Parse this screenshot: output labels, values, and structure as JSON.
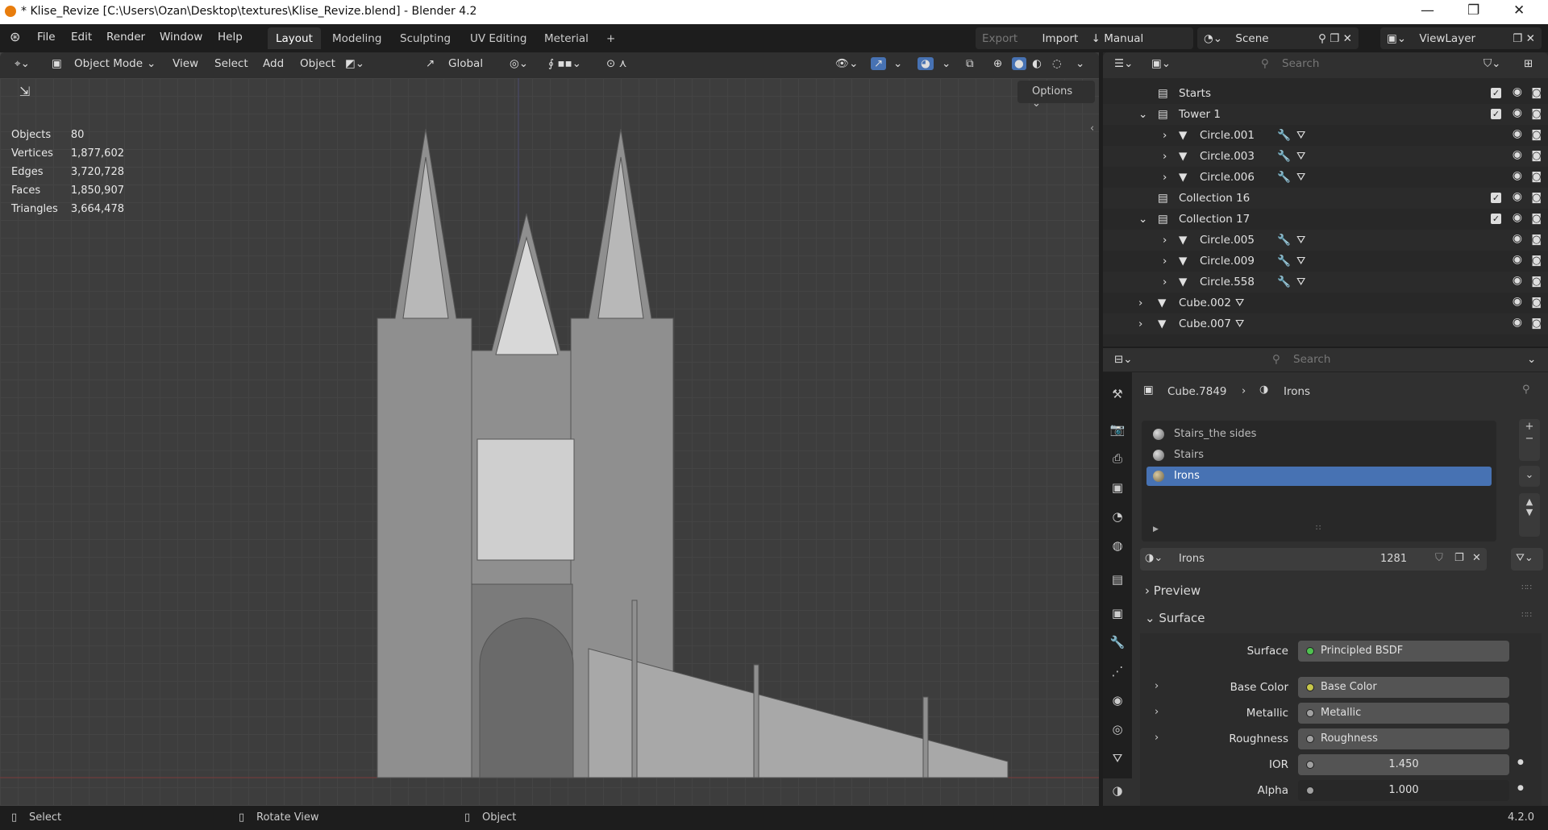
{
  "window": {
    "title": "* Klise_Revize [C:\\Users\\Ozan\\Desktop\\textures\\Klise_Revize.blend] - Blender 4.2",
    "minimize": "—",
    "maximize": "❐",
    "close": "✕"
  },
  "menu": [
    "File",
    "Edit",
    "Render",
    "Window",
    "Help"
  ],
  "workspaces": [
    "Layout",
    "Modeling",
    "Sculpting",
    "UV Editing",
    "Meterial",
    "+"
  ],
  "topright": {
    "export": "Export",
    "import": "Import",
    "manual": "Manual",
    "scene": "Scene",
    "viewlayer": "ViewLayer"
  },
  "viewport": {
    "mode": "Object Mode",
    "menus": [
      "View",
      "Select",
      "Add",
      "Object"
    ],
    "orientation": "Global",
    "options": "Options"
  },
  "stats": [
    {
      "k": "Objects",
      "v": "80"
    },
    {
      "k": "Vertices",
      "v": "1,877,602"
    },
    {
      "k": "Edges",
      "v": "3,720,728"
    },
    {
      "k": "Faces",
      "v": "1,850,907"
    },
    {
      "k": "Triangles",
      "v": "3,664,478"
    }
  ],
  "outliner": {
    "search_placeholder": "Search",
    "rows": [
      {
        "name": "Starts",
        "type": "collection",
        "indent": 0,
        "expand": "",
        "checked": true
      },
      {
        "name": "Tower 1",
        "type": "collection",
        "indent": 0,
        "expand": "v",
        "checked": true
      },
      {
        "name": "Circle.001",
        "type": "mesh",
        "indent": 1,
        "expand": ">",
        "mod": true
      },
      {
        "name": "Circle.003",
        "type": "mesh",
        "indent": 1,
        "expand": ">",
        "mod": true
      },
      {
        "name": "Circle.006",
        "type": "mesh",
        "indent": 1,
        "expand": ">",
        "mod": true
      },
      {
        "name": "Collection 16",
        "type": "collection",
        "indent": 0,
        "expand": "",
        "checked": true
      },
      {
        "name": "Collection 17",
        "type": "collection",
        "indent": 0,
        "expand": "v",
        "checked": true
      },
      {
        "name": "Circle.005",
        "type": "mesh",
        "indent": 1,
        "expand": ">",
        "mod": true
      },
      {
        "name": "Circle.009",
        "type": "mesh",
        "indent": 1,
        "expand": ">",
        "mod": true
      },
      {
        "name": "Circle.558",
        "type": "mesh",
        "indent": 1,
        "expand": ">",
        "mod": true
      },
      {
        "name": "Cube.002",
        "type": "mesh",
        "indent": -1,
        "expand": ">",
        "mod": false
      },
      {
        "name": "Cube.007",
        "type": "mesh",
        "indent": -1,
        "expand": ">",
        "mod": false
      }
    ]
  },
  "properties": {
    "search_placeholder": "Search",
    "breadcrumb": {
      "object": "Cube.7849",
      "material": "Irons"
    },
    "slots": [
      "Stairs_the sides",
      "Stairs",
      "Irons"
    ],
    "selected_slot": "Irons",
    "datablock": {
      "name": "Irons",
      "users": "1281"
    },
    "panels": {
      "preview": "Preview",
      "surface": "Surface"
    },
    "fields": [
      {
        "label": "Surface",
        "value": "Principled BSDF",
        "dot": "#4fc150",
        "expand": false,
        "numeric": false
      },
      {
        "label": "Base Color",
        "value": "Base Color",
        "dot": "#c7c74a",
        "expand": true,
        "numeric": false
      },
      {
        "label": "Metallic",
        "value": "Metallic",
        "dot": "#a1a1a1",
        "expand": true,
        "numeric": false
      },
      {
        "label": "Roughness",
        "value": "Roughness",
        "dot": "#a1a1a1",
        "expand": true,
        "numeric": false
      },
      {
        "label": "IOR",
        "value": "1.450",
        "dot": "#a1a1a1",
        "expand": false,
        "numeric": true
      },
      {
        "label": "Alpha",
        "value": "1.000",
        "dot": "#a1a1a1",
        "expand": false,
        "numeric": true
      }
    ]
  },
  "statusbar": {
    "select": "Select",
    "rotate": "Rotate View",
    "object": "Object",
    "version": "4.2.0"
  },
  "colors": {
    "accent": "#4772b3",
    "bg": "#303030"
  }
}
